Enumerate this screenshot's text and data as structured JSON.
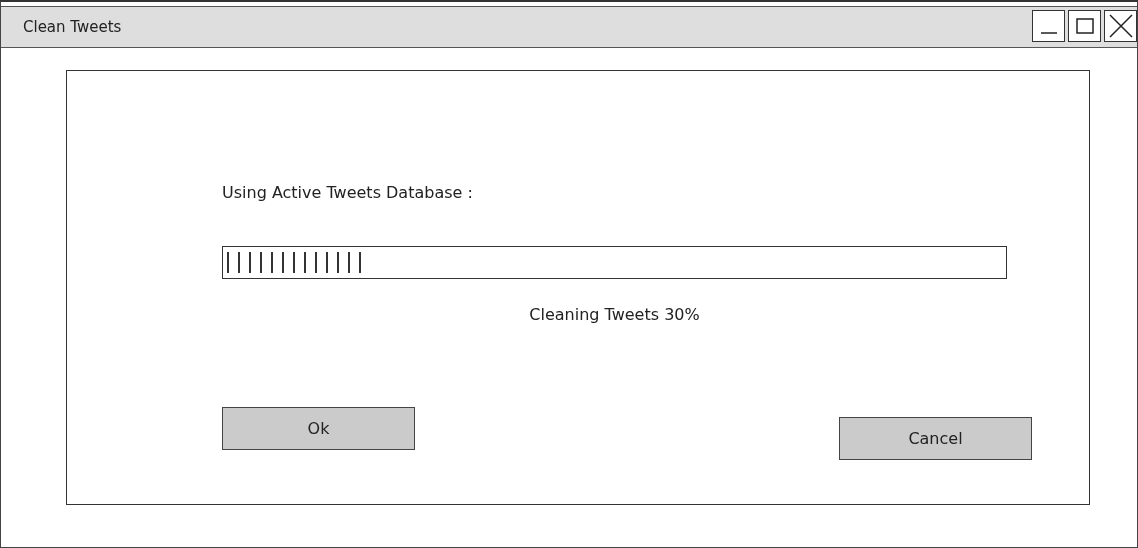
{
  "window": {
    "title": "Clean Tweets"
  },
  "database_label": "Using Active Tweets Database :",
  "progress": {
    "level": 0.18,
    "status": "Cleaning Tweets 30%"
  },
  "buttons": [
    {
      "label": "Ok",
      "kind": "primary"
    },
    {
      "label": "Cancel",
      "kind": "secondary"
    }
  ]
}
